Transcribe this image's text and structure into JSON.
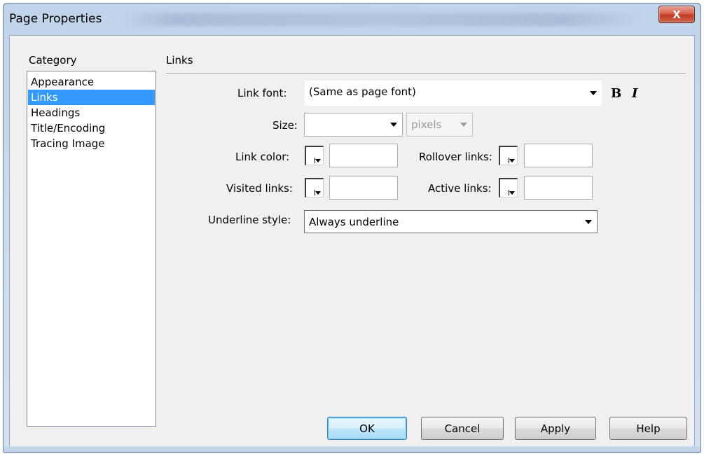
{
  "window": {
    "title": "Page Properties",
    "close_glyph": "X"
  },
  "sidebar": {
    "label": "Category",
    "items": [
      "Appearance",
      "Links",
      "Headings",
      "Title/Encoding",
      "Tracing Image"
    ],
    "selected": "Links"
  },
  "main": {
    "section_title": "Links",
    "link_font": {
      "label": "Link font:",
      "value": "(Same as page font)",
      "bold": "B",
      "italic": "I"
    },
    "size": {
      "label": "Size:",
      "value": "",
      "unit": "pixels"
    },
    "link_color": {
      "label": "Link color:",
      "value": ""
    },
    "rollover_links": {
      "label": "Rollover links:",
      "value": ""
    },
    "visited_links": {
      "label": "Visited links:",
      "value": ""
    },
    "active_links": {
      "label": "Active links:",
      "value": ""
    },
    "underline_style": {
      "label": "Underline style:",
      "value": "Always underline"
    }
  },
  "buttons": {
    "ok": "OK",
    "cancel": "Cancel",
    "apply": "Apply",
    "help": "Help"
  },
  "colors": {
    "selection": "#3399ff",
    "dialog_bg": "#f0f0f0",
    "frame": "#c9dbee",
    "close": "#c03a22"
  },
  "icons": [
    "close-icon",
    "dropdown-arrow-icon",
    "color-picker-icon",
    "bold-icon",
    "italic-icon"
  ]
}
